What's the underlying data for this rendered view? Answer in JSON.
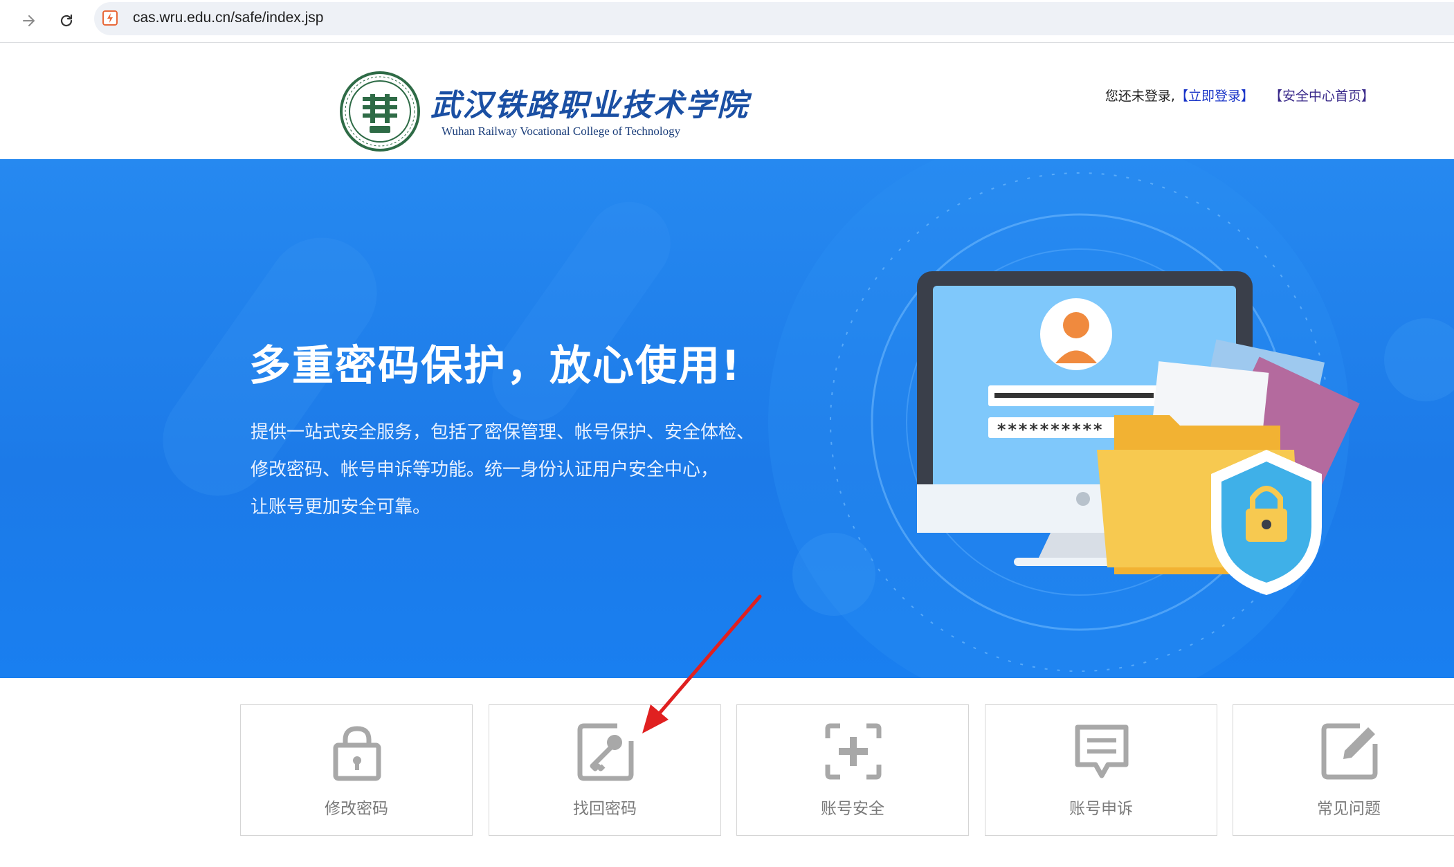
{
  "browser": {
    "url": "cas.wru.edu.cn/safe/index.jsp"
  },
  "header": {
    "logo_cn": "武汉铁路职业技术学院",
    "logo_en": "Wuhan Railway Vocational College of Technology",
    "status_text": "您还未登录,",
    "login_link": "【立即登录】",
    "home_link": "【安全中心首页】"
  },
  "banner": {
    "title": "多重密码保护，放心使用!",
    "desc_lines": [
      "提供一站式安全服务，包括了密保管理、帐号保护、安全体检、",
      "修改密码、帐号申诉等功能。统一身份认证用户安全中心，",
      "让账号更加安全可靠。"
    ],
    "password_mask": "**********"
  },
  "cards": [
    {
      "label": "修改密码",
      "icon": "lock-icon"
    },
    {
      "label": "找回密码",
      "icon": "key-icon"
    },
    {
      "label": "账号安全",
      "icon": "shield-plus-icon"
    },
    {
      "label": "账号申诉",
      "icon": "message-icon"
    },
    {
      "label": "常见问题",
      "icon": "edit-icon"
    }
  ],
  "colors": {
    "banner_blue": "#1c7ae8",
    "link_blue": "#1a35c8",
    "card_icon_gray": "#a8a8a8",
    "annotation_red": "#e02020"
  }
}
